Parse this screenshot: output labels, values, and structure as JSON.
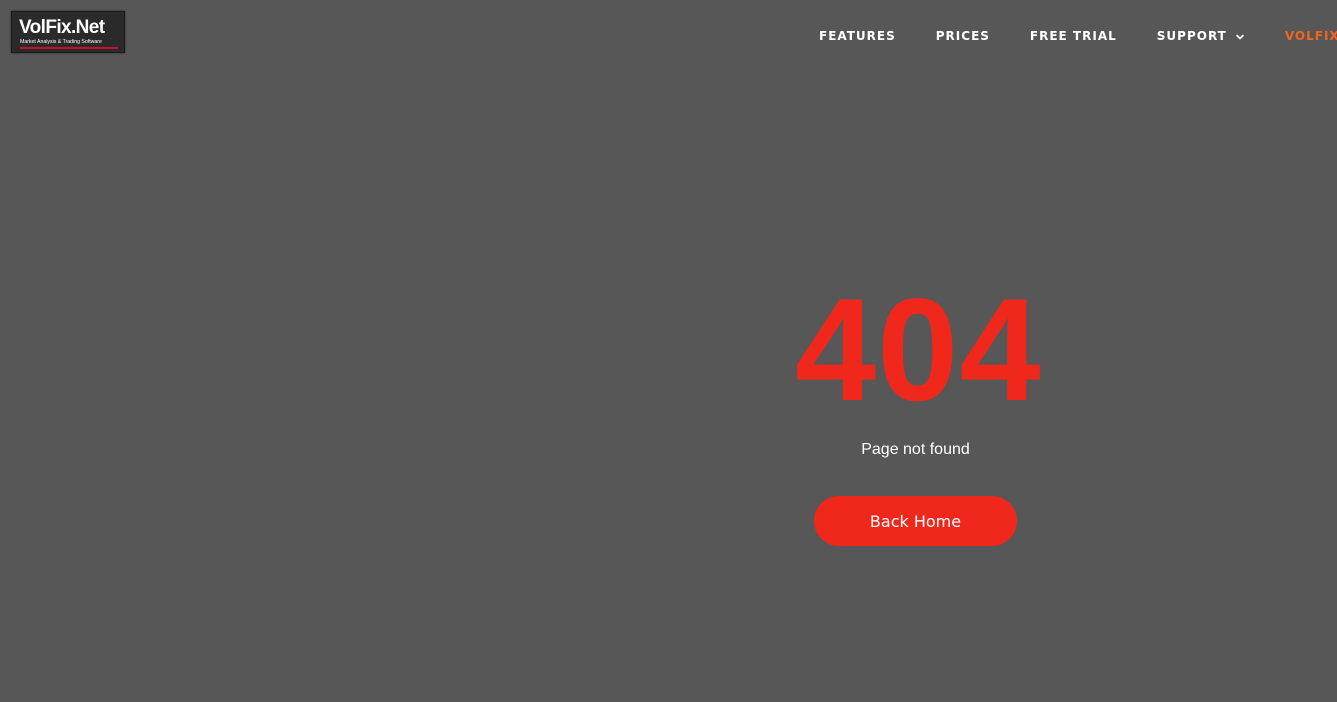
{
  "logo": {
    "name": "VolFix.Net",
    "tagline": "Market Analysis & Trading Software",
    "accent_color": "#c8102e"
  },
  "nav": {
    "items": [
      {
        "label": "FEATURES"
      },
      {
        "label": "PRICES"
      },
      {
        "label": "FREE TRIAL"
      },
      {
        "label": "SUPPORT",
        "icon": "chevron-down-icon"
      },
      {
        "label": "VOLFIX AC",
        "color": "#f26522"
      }
    ]
  },
  "error": {
    "code": "404",
    "message": "Page not found",
    "button_label": "Back Home",
    "color": "#f0281c"
  },
  "colors": {
    "background": "#575757"
  }
}
